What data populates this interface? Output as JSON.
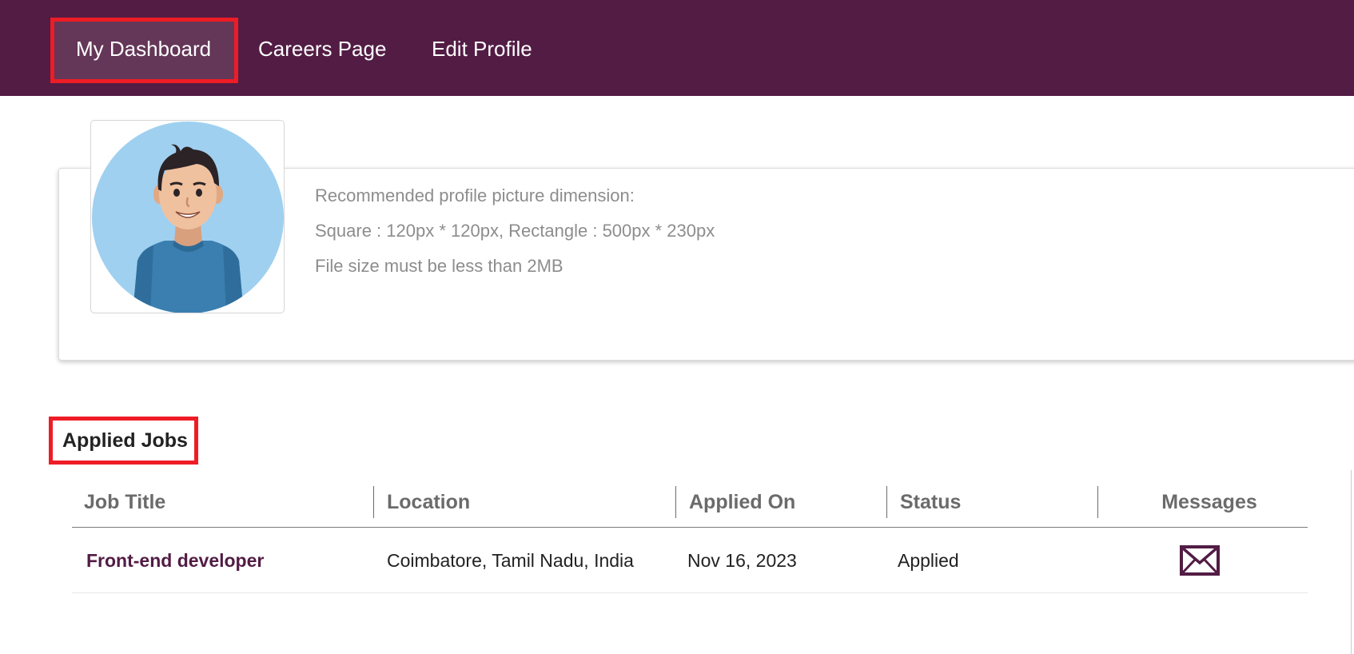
{
  "nav": {
    "items": [
      {
        "label": "My Dashboard",
        "active": true
      },
      {
        "label": "Careers Page",
        "active": false
      },
      {
        "label": "Edit Profile",
        "active": false
      }
    ]
  },
  "profile": {
    "avatar_icon": "user-avatar-icon",
    "notes": [
      "Recommended profile picture dimension:",
      "Square : 120px * 120px, Rectangle : 500px * 230px",
      "File size must be less than 2MB"
    ]
  },
  "applied_jobs": {
    "title": "Applied Jobs",
    "columns": [
      "Job Title",
      "Location",
      "Applied On",
      "Status",
      "Messages"
    ],
    "rows": [
      {
        "job_title": "Front-end developer",
        "location": "Coimbatore, Tamil Nadu, India",
        "applied_on": "Nov 16, 2023",
        "status": "Applied",
        "messages_icon": "envelope-icon"
      }
    ]
  },
  "colors": {
    "brand": "#521c44",
    "nav_active": "#643658",
    "highlight": "#ee1c25",
    "muted_text": "#8d8d8d"
  }
}
